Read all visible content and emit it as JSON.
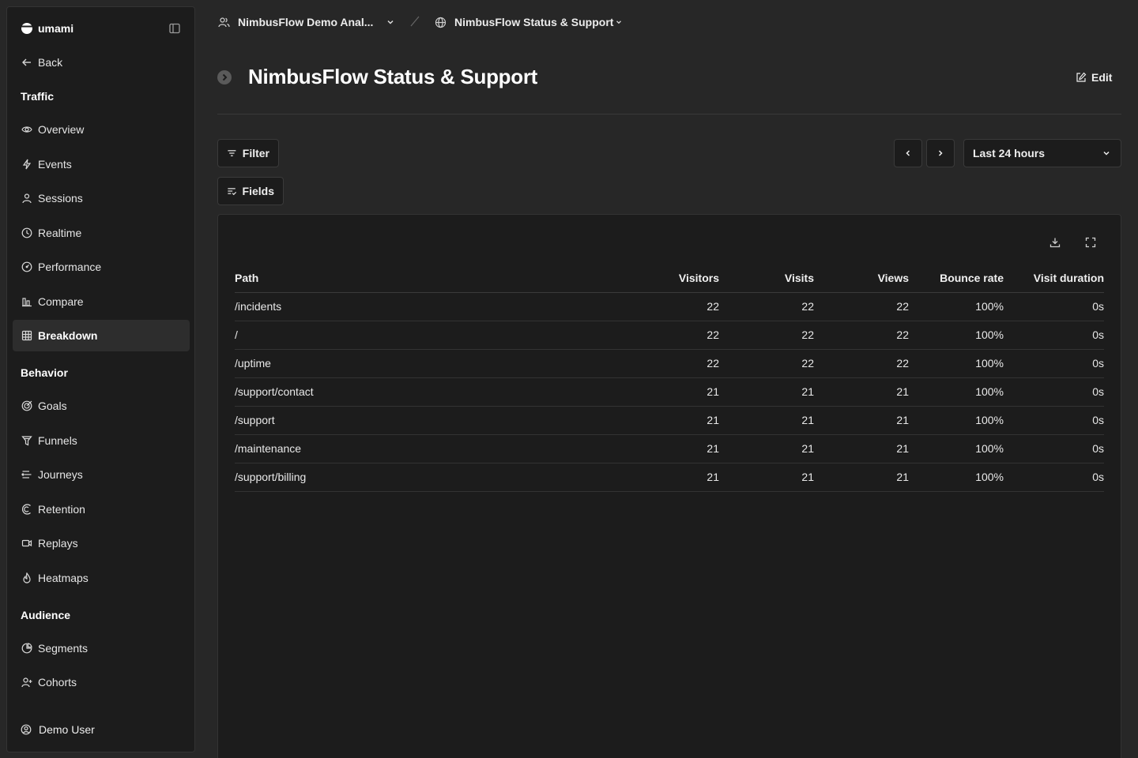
{
  "sidebar": {
    "brand": "umami",
    "back": "Back",
    "sections": {
      "traffic": "Traffic",
      "behavior": "Behavior",
      "audience": "Audience"
    },
    "items": {
      "overview": "Overview",
      "events": "Events",
      "sessions": "Sessions",
      "realtime": "Realtime",
      "performance": "Performance",
      "compare": "Compare",
      "breakdown": "Breakdown",
      "goals": "Goals",
      "funnels": "Funnels",
      "journeys": "Journeys",
      "retention": "Retention",
      "replays": "Replays",
      "heatmaps": "Heatmaps",
      "segments": "Segments",
      "cohorts": "Cohorts"
    },
    "active": "breakdown",
    "user": "Demo User"
  },
  "header": {
    "team": "NimbusFlow Demo Anal...",
    "website": "NimbusFlow Status & Support",
    "title": "NimbusFlow Status & Support",
    "edit_label": "Edit"
  },
  "toolbar": {
    "filter_label": "Filter",
    "fields_label": "Fields",
    "date_range": "Last 24 hours"
  },
  "table": {
    "columns": [
      "Path",
      "Visitors",
      "Visits",
      "Views",
      "Bounce rate",
      "Visit duration"
    ],
    "rows": [
      [
        "/incidents",
        "22",
        "22",
        "22",
        "100%",
        "0s"
      ],
      [
        "/",
        "22",
        "22",
        "22",
        "100%",
        "0s"
      ],
      [
        "/uptime",
        "22",
        "22",
        "22",
        "100%",
        "0s"
      ],
      [
        "/support/contact",
        "21",
        "21",
        "21",
        "100%",
        "0s"
      ],
      [
        "/support",
        "21",
        "21",
        "21",
        "100%",
        "0s"
      ],
      [
        "/maintenance",
        "21",
        "21",
        "21",
        "100%",
        "0s"
      ],
      [
        "/support/billing",
        "21",
        "21",
        "21",
        "100%",
        "0s"
      ]
    ]
  },
  "colors": {
    "background": "#272727",
    "panel": "#1c1c1c",
    "active_item": "#2d2d2d",
    "text": "#ededed"
  }
}
